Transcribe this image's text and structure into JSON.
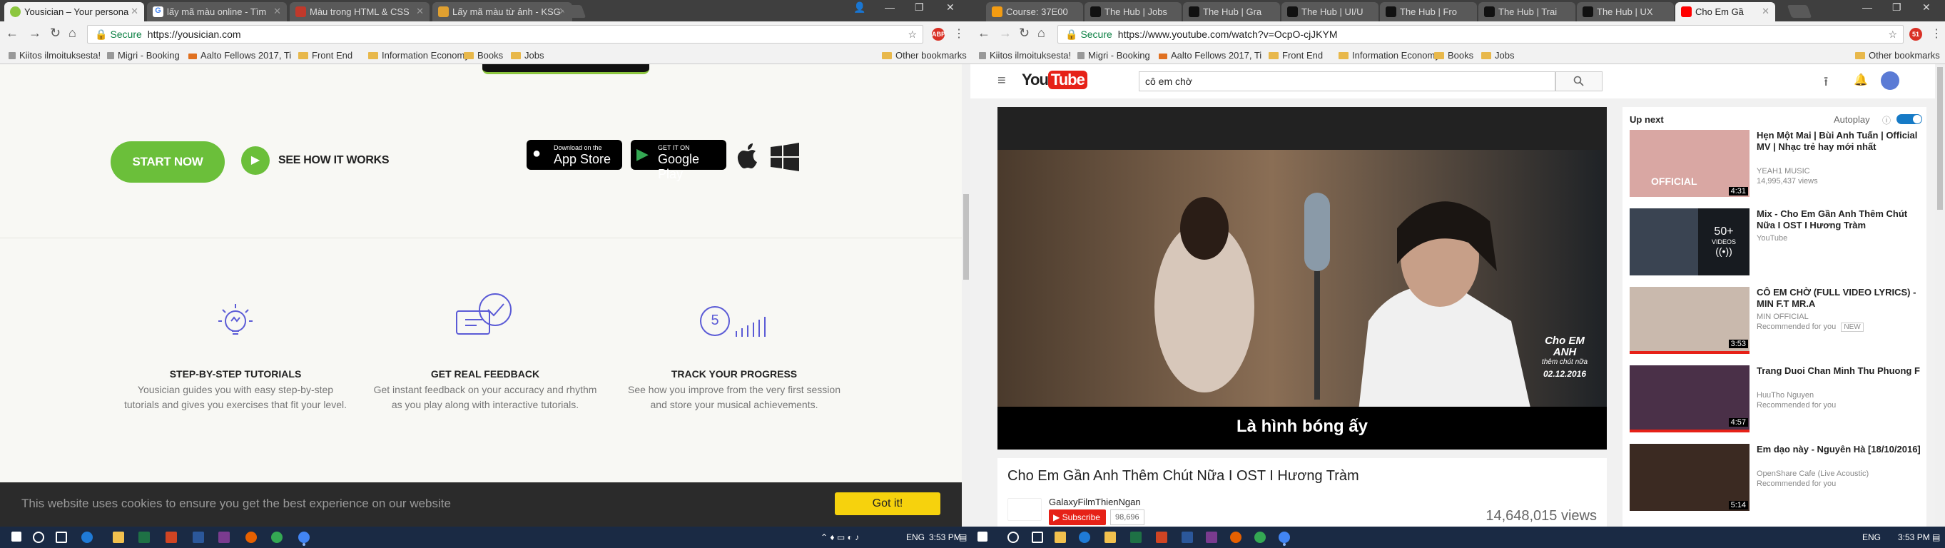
{
  "left": {
    "tabs": [
      {
        "title": "Yousician – Your persona",
        "color": "#8cc63f"
      },
      {
        "title": "lấy mã màu online - Tìm",
        "color": "#4285f4"
      },
      {
        "title": "Màu trong HTML & CSS",
        "color": "#c0392b"
      },
      {
        "title": "Lấy mã màu từ ảnh - KSG",
        "color": "#e0a030"
      }
    ],
    "omnibox": {
      "secure": "Secure",
      "url": "https://yousician.com"
    },
    "bookmarks": [
      "Kiitos ilmoituksesta!",
      "Migri - Booking",
      "Aalto Fellows 2017, Ti",
      "Front End",
      "Information Economy",
      "Books",
      "Jobs"
    ],
    "other_bookmarks": "Other bookmarks",
    "hero": {
      "start": "START NOW",
      "see": "SEE HOW IT WORKS",
      "appstore_small": "Download on the",
      "appstore": "App Store",
      "gplay_small": "GET IT ON",
      "gplay": "Google Play"
    },
    "features": [
      {
        "title": "STEP-BY-STEP TUTORIALS",
        "text": "Yousician guides you with easy step-by-step tutorials and gives you exercises that fit your level."
      },
      {
        "title": "GET REAL FEEDBACK",
        "text": "Get instant feedback on your accuracy and rhythm as you play along with interactive tutorials."
      },
      {
        "title": "TRACK YOUR PROGRESS",
        "text": "See how you improve from the very first session and store your musical achievements."
      }
    ],
    "progress_number": "5",
    "cookie": {
      "text": "This website uses cookies to ensure you get the best experience on our website",
      "button": "Got it!"
    },
    "tray": {
      "lang": "ENG",
      "time": "3:53 PM"
    }
  },
  "right": {
    "tabs": [
      {
        "title": "Course: 37E00",
        "color": "#f39c12"
      },
      {
        "title": "The Hub | Jobs",
        "color": "#222222"
      },
      {
        "title": "The Hub | Gra",
        "color": "#222222"
      },
      {
        "title": "The Hub | UI/U",
        "color": "#222222"
      },
      {
        "title": "The Hub | Fro",
        "color": "#222222"
      },
      {
        "title": "The Hub | Trai",
        "color": "#222222"
      },
      {
        "title": "The Hub | UX",
        "color": "#222222"
      },
      {
        "title": "Cho Em Gầ",
        "color": "#ff0000"
      }
    ],
    "omnibox": {
      "secure": "Secure",
      "url": "https://www.youtube.com/watch?v=OcpO-cjJKYM"
    },
    "bookmarks": [
      "Kiitos ilmoituksesta!",
      "Migri - Booking",
      "Aalto Fellows 2017, Ti",
      "Front End",
      "Information Economy",
      "Books",
      "Jobs"
    ],
    "other_bookmarks": "Other bookmarks",
    "ext_count": "51",
    "yt": {
      "logo": "YouTube",
      "search": "cô em chờ",
      "subtitle": "Là hình bóng ấy",
      "watermark_title": "Cho EM ANH",
      "watermark_sub": "thêm chút nữa",
      "watermark_date": "02.12.2016",
      "title": "Cho Em Gần Anh Thêm Chút Nữa I OST I Hương Tràm",
      "channel": "GalaxyFilmThienNgan",
      "subscribe": "Subscribe",
      "sub_count": "98,696",
      "views": "14,648,015 views",
      "up_next": "Up next",
      "autoplay": "Autoplay",
      "sidebar": [
        {
          "title": "Hẹn Một Mai | Bùi Anh Tuấn | Official MV | Nhạc trẻ hay mới nhất",
          "channel": "YEAH1 MUSIC",
          "meta": "14,995,437 views",
          "duration": "4:31",
          "thumb_text": "OFFICIAL",
          "thumb_color": "#d9a7a3",
          "new": ""
        },
        {
          "title": "Mix - Cho Em Gần Anh Thêm Chút Nữa I OST I Hương Tràm",
          "channel": "YouTube",
          "meta": "",
          "duration": "",
          "thumb_text": "",
          "thumb_color": "#3a4452",
          "new": ""
        },
        {
          "title": "CÔ EM CHỜ (FULL VIDEO LYRICS) - MIN F.T MR.A",
          "channel": "MIN OFFICIAL",
          "meta": "Recommended for you",
          "duration": "3:53",
          "thumb_text": "",
          "thumb_color": "#c9b9ad",
          "new": "NEW"
        },
        {
          "title": "Trang Duoi Chan Minh Thu Phuong F",
          "channel": "HuuTho Nguyen",
          "meta": "Recommended for you",
          "duration": "4:57",
          "thumb_text": "",
          "thumb_color": "#4a3048",
          "new": ""
        },
        {
          "title": "Em dạo này - Nguyên Hà [18/10/2016]",
          "channel": "OpenShare Cafe (Live Acoustic)",
          "meta": "Recommended for you",
          "duration": "5:14",
          "thumb_text": "",
          "thumb_color": "#3b2a22",
          "new": ""
        }
      ],
      "mix_count": "50+",
      "mix_label": "VIDEOS"
    },
    "tray": {
      "lang": "ENG",
      "time": "3:53 PM"
    }
  }
}
